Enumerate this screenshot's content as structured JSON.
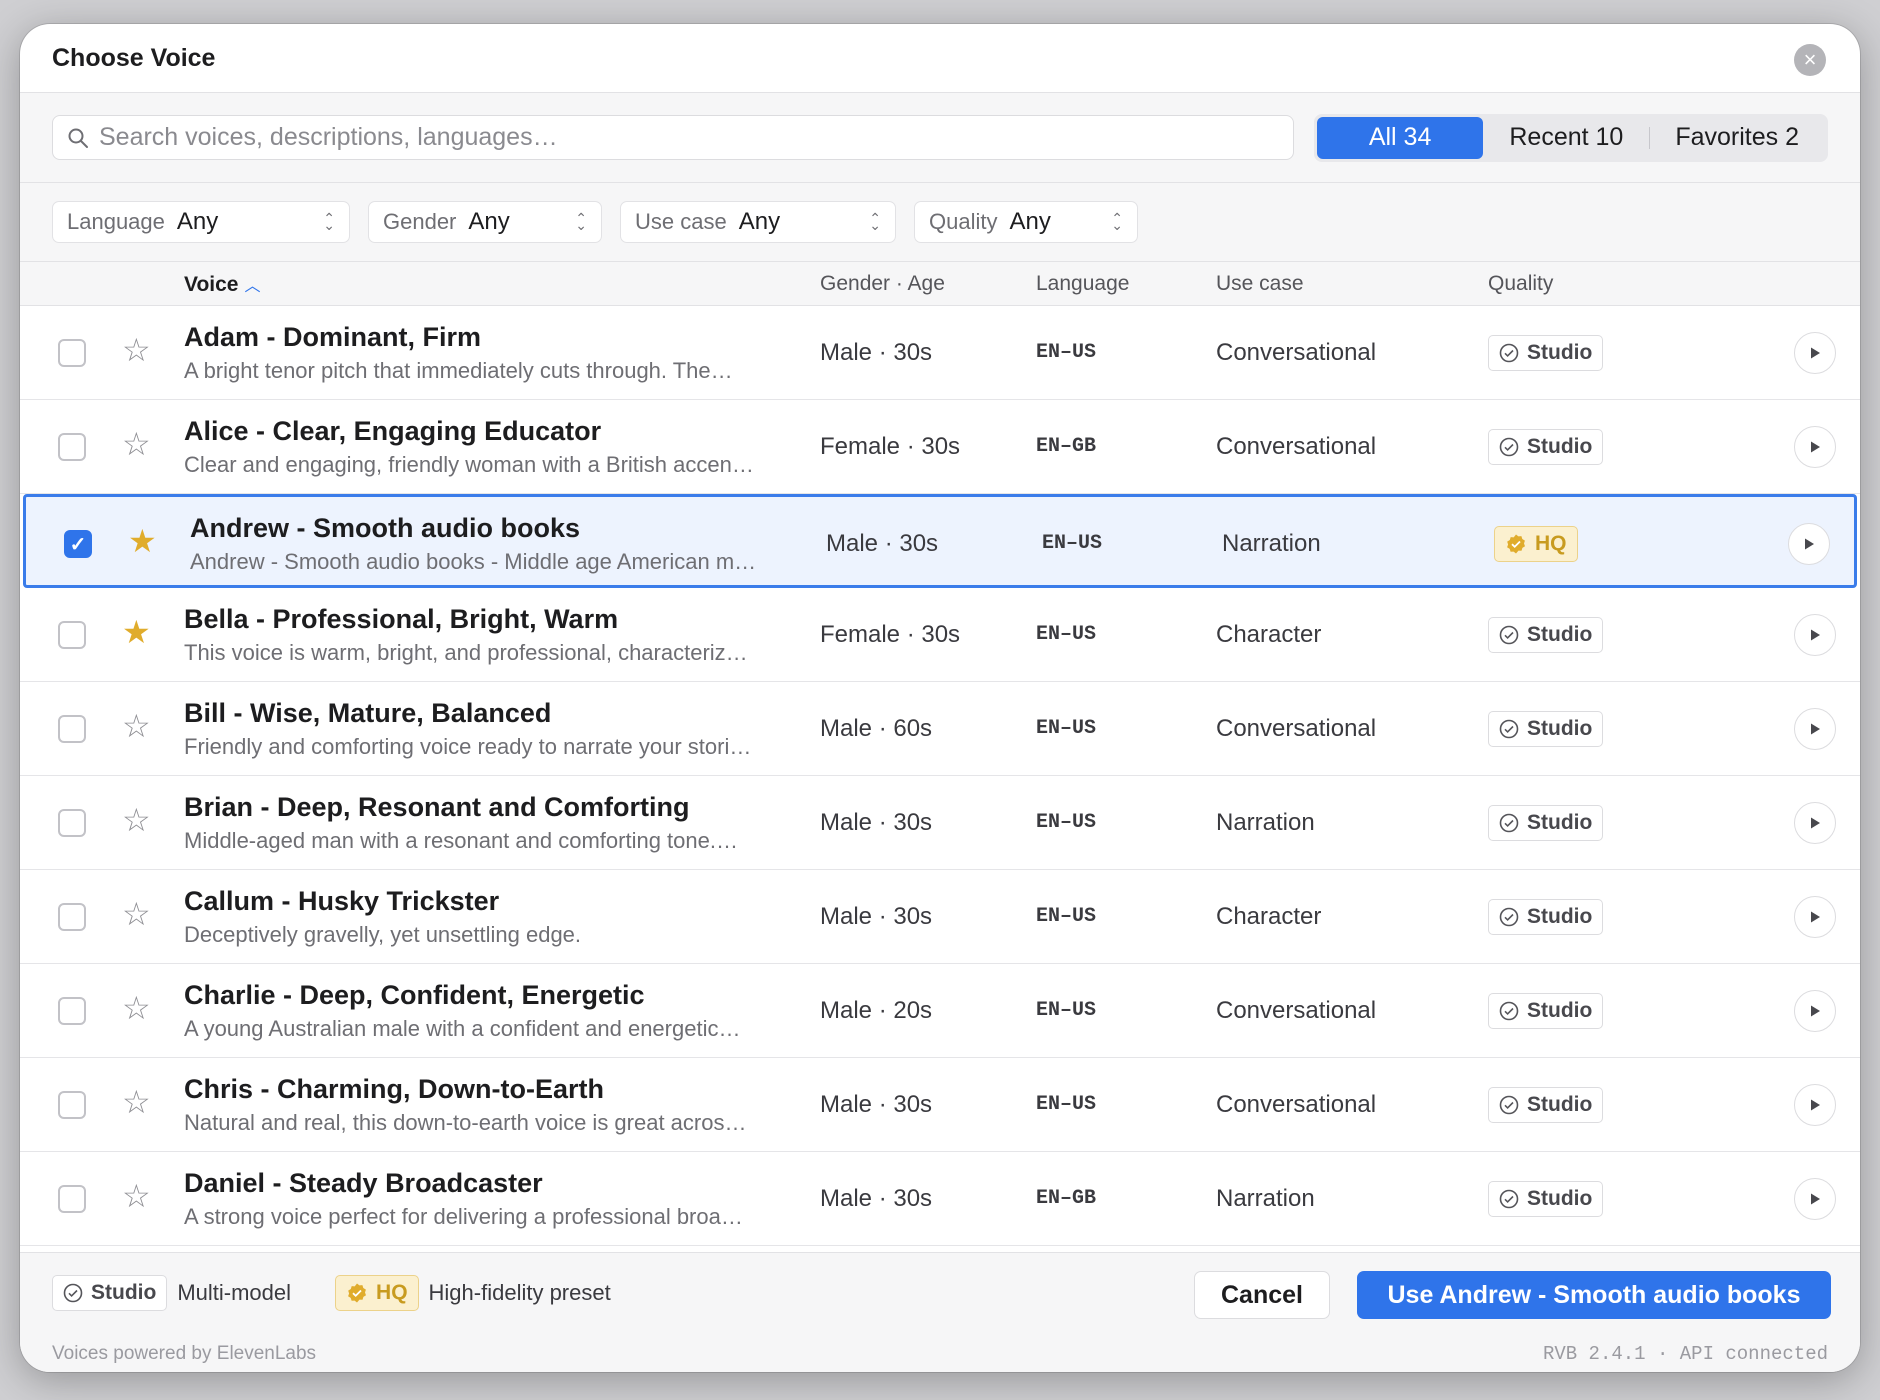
{
  "dialog": {
    "title": "Choose Voice",
    "close_icon": "close-icon"
  },
  "search": {
    "placeholder": "Search voices, descriptions, languages…",
    "value": ""
  },
  "tabs": [
    {
      "label": "All 34",
      "active": true
    },
    {
      "label": "Recent 10",
      "active": false
    },
    {
      "label": "Favorites 2",
      "active": false
    }
  ],
  "filters": [
    {
      "label": "Language",
      "value": "Any"
    },
    {
      "label": "Gender",
      "value": "Any"
    },
    {
      "label": "Use case",
      "value": "Any"
    },
    {
      "label": "Quality",
      "value": "Any"
    }
  ],
  "columns": {
    "voice": "Voice",
    "gender_age": "Gender · Age",
    "language": "Language",
    "use_case": "Use case",
    "quality": "Quality"
  },
  "voices": [
    {
      "name": "Adam - Dominant, Firm",
      "desc": "A bright tenor pitch that immediately cuts through. The…",
      "gender_age": "Male · 30s",
      "lang": "EN–US",
      "use_case": "Conversational",
      "quality": "Studio",
      "hq": false,
      "fav": false,
      "checked": false
    },
    {
      "name": "Alice - Clear, Engaging Educator",
      "desc": "Clear and engaging, friendly woman with a British accen…",
      "gender_age": "Female · 30s",
      "lang": "EN–GB",
      "use_case": "Conversational",
      "quality": "Studio",
      "hq": false,
      "fav": false,
      "checked": false
    },
    {
      "name": "Andrew - Smooth audio books",
      "desc": "Andrew - Smooth audio books - Middle age American m…",
      "gender_age": "Male · 30s",
      "lang": "EN–US",
      "use_case": "Narration",
      "quality": "HQ",
      "hq": true,
      "fav": true,
      "checked": true
    },
    {
      "name": "Bella - Professional, Bright, Warm",
      "desc": "This voice is warm, bright, and professional, characteriz…",
      "gender_age": "Female · 30s",
      "lang": "EN–US",
      "use_case": "Character",
      "quality": "Studio",
      "hq": false,
      "fav": true,
      "checked": false
    },
    {
      "name": "Bill - Wise, Mature, Balanced",
      "desc": "Friendly and comforting voice ready to narrate your stori…",
      "gender_age": "Male · 60s",
      "lang": "EN–US",
      "use_case": "Conversational",
      "quality": "Studio",
      "hq": false,
      "fav": false,
      "checked": false
    },
    {
      "name": "Brian - Deep, Resonant and Comforting",
      "desc": "Middle-aged man with a resonant and comforting tone.…",
      "gender_age": "Male · 30s",
      "lang": "EN–US",
      "use_case": "Narration",
      "quality": "Studio",
      "hq": false,
      "fav": false,
      "checked": false
    },
    {
      "name": "Callum - Husky Trickster",
      "desc": "Deceptively gravelly, yet unsettling edge.",
      "gender_age": "Male · 30s",
      "lang": "EN–US",
      "use_case": "Character",
      "quality": "Studio",
      "hq": false,
      "fav": false,
      "checked": false
    },
    {
      "name": "Charlie - Deep, Confident, Energetic",
      "desc": "A young Australian male with a confident and energetic…",
      "gender_age": "Male · 20s",
      "lang": "EN–US",
      "use_case": "Conversational",
      "quality": "Studio",
      "hq": false,
      "fav": false,
      "checked": false
    },
    {
      "name": "Chris - Charming, Down-to-Earth",
      "desc": "Natural and real, this down-to-earth voice is great acros…",
      "gender_age": "Male · 30s",
      "lang": "EN–US",
      "use_case": "Conversational",
      "quality": "Studio",
      "hq": false,
      "fav": false,
      "checked": false
    },
    {
      "name": "Daniel - Steady Broadcaster",
      "desc": "A strong voice perfect for delivering a professional broa…",
      "gender_age": "Male · 30s",
      "lang": "EN–GB",
      "use_case": "Narration",
      "quality": "Studio",
      "hq": false,
      "fav": false,
      "checked": false
    }
  ],
  "legend": {
    "studio_badge": "Studio",
    "studio_text": "Multi-model",
    "hq_badge": "HQ",
    "hq_text": "High-fidelity preset"
  },
  "buttons": {
    "cancel": "Cancel",
    "confirm": "Use Andrew - Smooth audio books"
  },
  "footer": {
    "powered": "Voices powered by ElevenLabs",
    "version": "RVB 2.4.1 · API connected"
  },
  "colors": {
    "accent": "#2f74ea",
    "star_on": "#e0ac2c",
    "hq_badge": "#c89b1f"
  }
}
